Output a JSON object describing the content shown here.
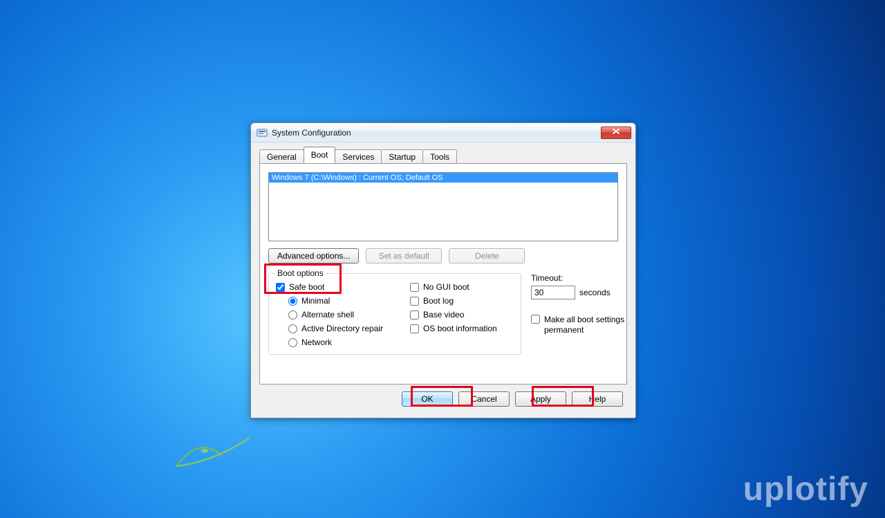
{
  "window": {
    "title": "System Configuration"
  },
  "tabs": {
    "general": "General",
    "boot": "Boot",
    "services": "Services",
    "startup": "Startup",
    "tools": "Tools"
  },
  "bootList": {
    "item0": "Windows 7 (C:\\Windows) : Current OS; Default OS"
  },
  "buttons": {
    "advanced": "Advanced options...",
    "set_default": "Set as default",
    "delete": "Delete",
    "ok": "OK",
    "cancel": "Cancel",
    "apply": "Apply",
    "help": "Help"
  },
  "bootOptions": {
    "group_label": "Boot options",
    "safe_boot": "Safe boot",
    "minimal": "Minimal",
    "alt_shell": "Alternate shell",
    "ad_repair": "Active Directory repair",
    "network": "Network",
    "no_gui": "No GUI boot",
    "boot_log": "Boot log",
    "base_video": "Base video",
    "os_boot_info": "OS boot information"
  },
  "timeout": {
    "label": "Timeout:",
    "value": "30",
    "unit": "seconds"
  },
  "permanent": {
    "label": "Make all boot settings permanent"
  },
  "watermark": "uplotify"
}
